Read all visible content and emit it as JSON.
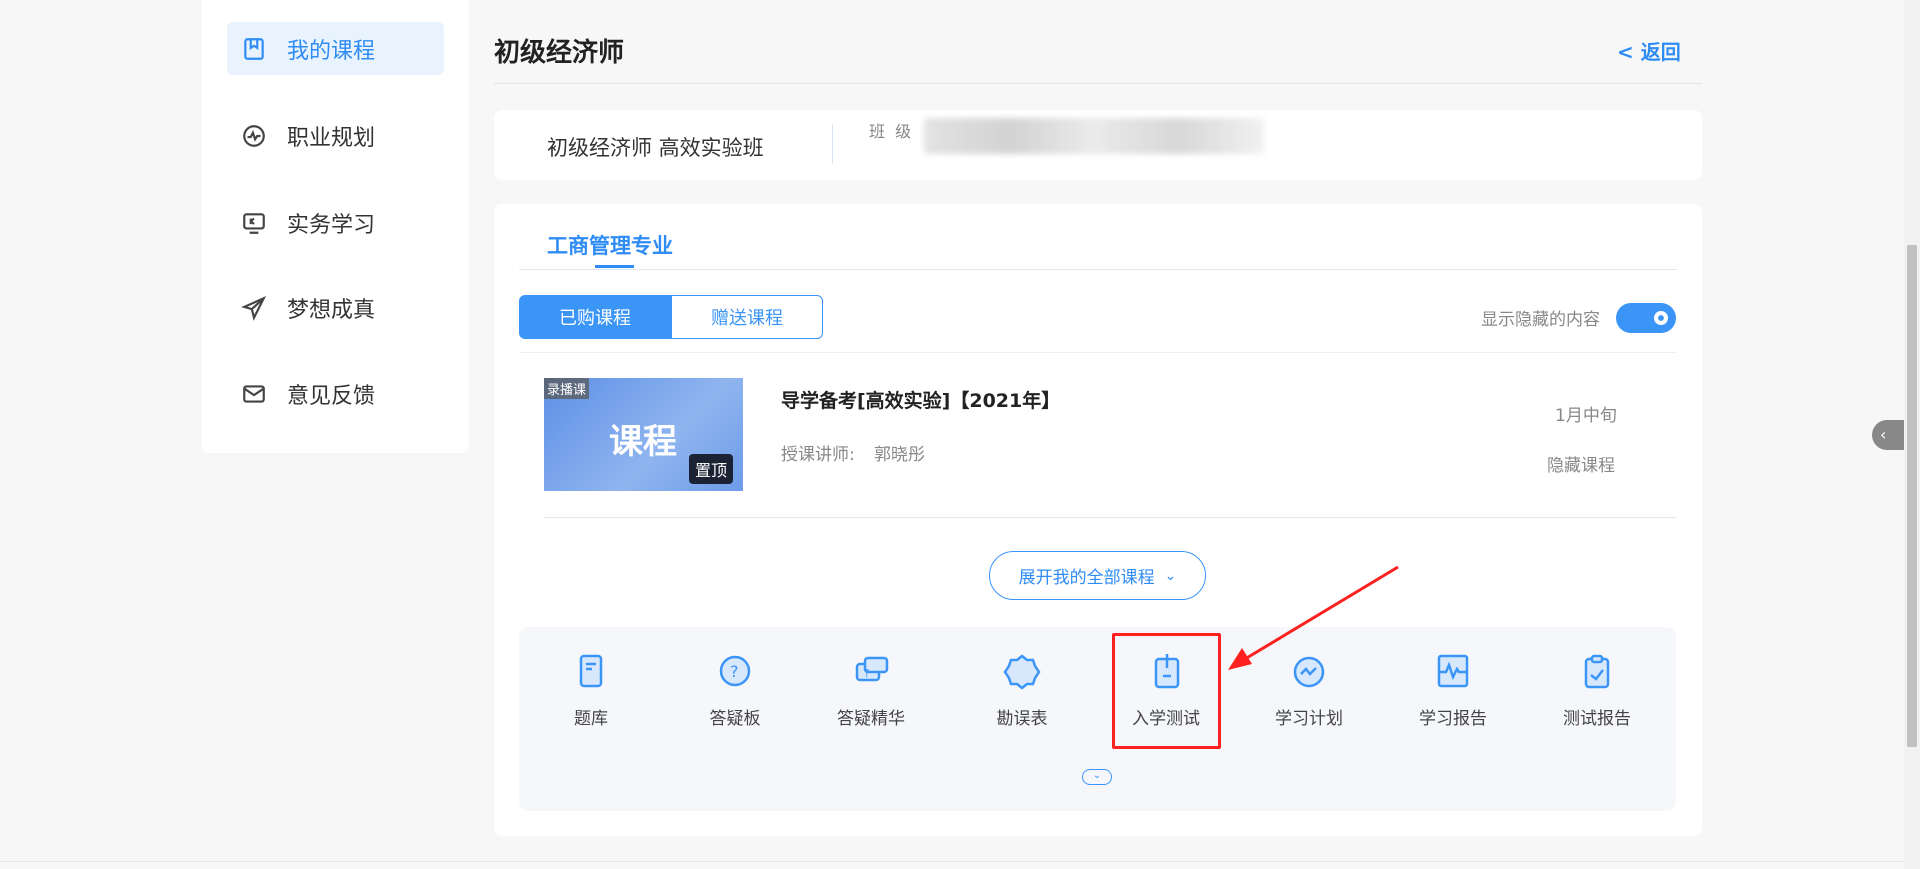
{
  "sidebar": {
    "items": [
      {
        "label": "我的课程",
        "icon": "bookmark-icon"
      },
      {
        "label": "职业规划",
        "icon": "pulse-icon"
      },
      {
        "label": "实务学习",
        "icon": "monitor-icon"
      },
      {
        "label": "梦想成真",
        "icon": "send-icon"
      },
      {
        "label": "意见反馈",
        "icon": "mail-icon"
      }
    ]
  },
  "header": {
    "title": "初级经济师",
    "back": "< 返回"
  },
  "class_card": {
    "name": "初级经济师 高效实验班",
    "class_label": "班  级"
  },
  "major_tab": "工商管理专业",
  "course_tabs": [
    "已购课程",
    "赠送课程"
  ],
  "toggle": {
    "label": "显示隐藏的内容",
    "on": true
  },
  "course": {
    "badge": "录播课",
    "thumb_text": "课程",
    "pin": "置顶",
    "title": "导学备考[高效实验]【2021年】",
    "teacher_label": "授课讲师:",
    "teacher": "郭晓彤",
    "time": "1月中旬",
    "hide": "隐藏课程"
  },
  "expand_button": "展开我的全部课程",
  "tools": [
    {
      "label": "题库"
    },
    {
      "label": "答疑板"
    },
    {
      "label": "答疑精华"
    },
    {
      "label": "勘误表"
    },
    {
      "label": "入学测试"
    },
    {
      "label": "学习计划"
    },
    {
      "label": "学习报告"
    },
    {
      "label": "测试报告"
    }
  ],
  "colors": {
    "accent": "#2f8cf5",
    "annotation": "#ff2020"
  }
}
